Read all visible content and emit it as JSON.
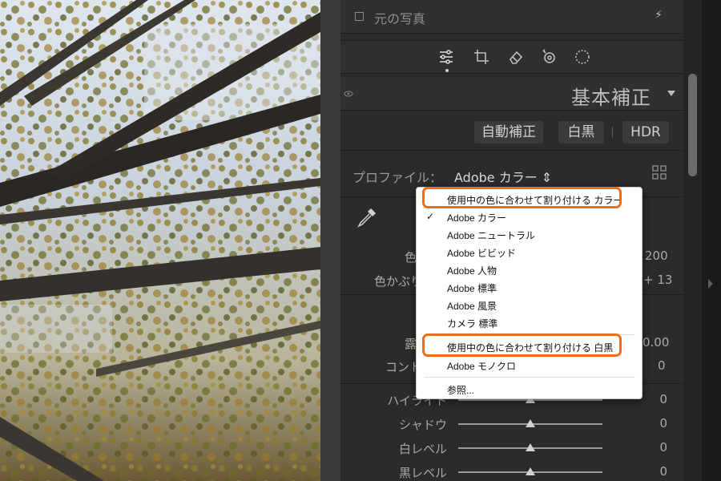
{
  "panel": {
    "original_photo_label": "元の写真",
    "section_title": "基本補正",
    "buttons": {
      "auto": "自動補正",
      "bw": "白黒",
      "hdr": "HDR"
    },
    "profile_label": "プロファイル：",
    "profile_value": "Adobe カラー ⇕",
    "wb": {
      "temp_label_partial": "色",
      "tint_label_partial": "色かぶり",
      "temp_value_partial": "200",
      "tint_value_partial": "+ 13"
    },
    "tone": {
      "exposure_label_partial": "露",
      "exposure_value_partial": "0.00",
      "contrast_label_partial": "コント",
      "contrast_value": "0"
    },
    "sliders": [
      {
        "label": "ハイライト",
        "value": "0",
        "level": 0.5
      },
      {
        "label": "シャドウ",
        "value": "0",
        "level": 0.5
      },
      {
        "label": "白レベル",
        "value": "0",
        "level": 0.5
      },
      {
        "label": "黒レベル",
        "value": "0",
        "level": 0.5
      }
    ]
  },
  "menu": {
    "items": [
      {
        "label": "使用中の色に合わせて割り付ける カラー",
        "checked": false,
        "highlighted": true
      },
      {
        "label": "Adobe カラー",
        "checked": true,
        "highlighted": false
      },
      {
        "label": "Adobe ニュートラル",
        "checked": false,
        "highlighted": false
      },
      {
        "label": "Adobe ビビッド",
        "checked": false,
        "highlighted": false
      },
      {
        "label": "Adobe 人物",
        "checked": false,
        "highlighted": false
      },
      {
        "label": "Adobe 標準",
        "checked": false,
        "highlighted": false
      },
      {
        "label": "Adobe 風景",
        "checked": false,
        "highlighted": false
      },
      {
        "label": "カメラ 標準",
        "checked": false,
        "highlighted": false
      },
      {
        "label": "使用中の色に合わせて割り付ける 白黒",
        "checked": false,
        "highlighted": true
      },
      {
        "label": "Adobe モノクロ",
        "checked": false,
        "highlighted": false
      },
      {
        "label": "参照...",
        "checked": false,
        "highlighted": false
      }
    ],
    "check_mark": "✓"
  },
  "colors": {
    "highlight_outline": "#ee6c1e",
    "panel_bg": "#2b2b2b"
  }
}
